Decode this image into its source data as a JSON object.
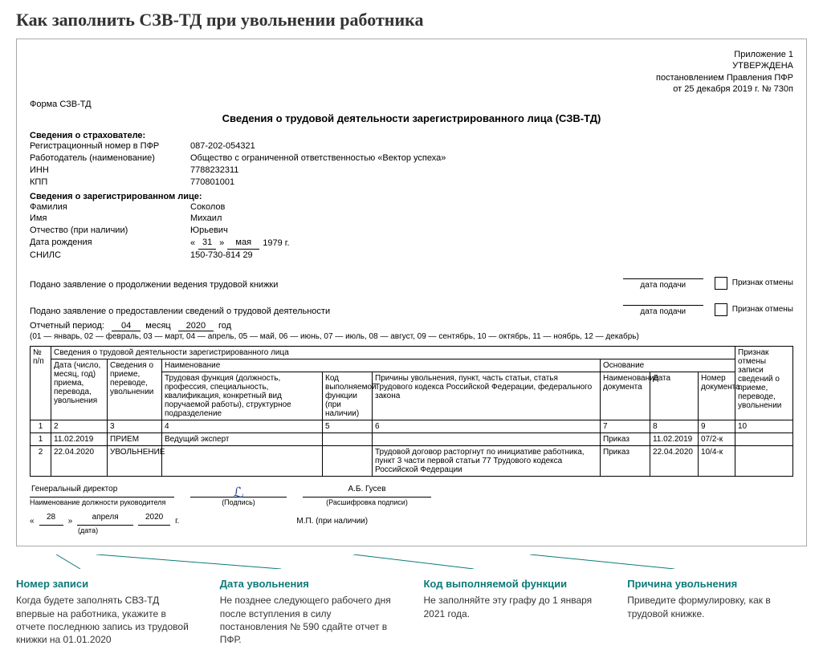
{
  "pageTitle": "Как заполнить СЗВ-ТД при увольнении работника",
  "topRight": {
    "l1": "Приложение 1",
    "l2": "УТВЕРЖДЕНА",
    "l3": "постановлением Правления ПФР",
    "l4": "от 25 декабря 2019 г. № 730п"
  },
  "formCode": "Форма СЗВ-ТД",
  "formTitle": "Сведения о трудовой деятельности зарегистрированного лица (СЗВ-ТД)",
  "sectionInsurer": "Сведения о страхователе:",
  "insurer": {
    "regLabel": "Регистрационный номер в ПФР",
    "regVal": "087-202-054321",
    "empLabel": "Работодатель (наименование)",
    "empVal": "Общество с ограниченной ответственностью «Вектор успеха»",
    "innLabel": "ИНН",
    "innVal": "7788232311",
    "kppLabel": "КПП",
    "kppVal": "770801001"
  },
  "sectionPerson": "Сведения о зарегистрированном лице:",
  "person": {
    "famLabel": "Фамилия",
    "famVal": "Соколов",
    "nameLabel": "Имя",
    "nameVal": "Михаил",
    "patLabel": "Отчество (при наличии)",
    "patVal": "Юрьевич",
    "dobLabel": "Дата рождения",
    "dobDay": "31",
    "dobMonth": "мая",
    "dobYear": "1979 г.",
    "snilsLabel": "СНИЛС",
    "snilsVal": "150-730-814 29"
  },
  "app1": "Подано заявление о продолжении ведения трудовой книжки",
  "app2": "Подано заявление о предоставлении сведений о трудовой деятельности",
  "dateSubmit": "дата подачи",
  "cancelFlag": "Признак отмены",
  "reportPeriod": {
    "label": "Отчетный период:",
    "monthVal": "04",
    "monthLbl": "месяц",
    "yearVal": "2020",
    "yearLbl": "год"
  },
  "monthsLine": "(01 — январь, 02 — февраль, 03 — март, 04 — апрель, 05 — май, 06 — июнь, 07 — июль, 08 — август, 09 — сентябрь, 10 — октябрь, 11 — ноябрь, 12 — декабрь)",
  "table": {
    "hdr_np": "№ п/п",
    "hdr_group": "Сведения о трудовой деятельности зарегистрированного лица",
    "hdr_cancel": "Признак отмены записи сведений о приеме, переводе, увольнении",
    "hdr_date": "Дата (число, месяц, год) приема, перевода, увольнения",
    "hdr_event": "Сведения о приеме, переводе, увольнении",
    "hdr_name": "Наименование",
    "hdr_func": "Трудовая функция (должность, профессия, специальность, квалификация, конкретный вид поручаемой работы), структурное подразделение",
    "hdr_code": "Код выполняемой функции (при наличии)",
    "hdr_reason": "Причины увольнения, пункт, часть статьи, статья Трудового кодекса Российской Федерации, федерального закона",
    "hdr_basis": "Основание",
    "hdr_docname": "Наименование документа",
    "hdr_docdate": "Дата",
    "hdr_docnum": "Номер документа",
    "nums": [
      "1",
      "2",
      "3",
      "4",
      "5",
      "6",
      "7",
      "8",
      "9",
      "10"
    ],
    "rows": [
      {
        "np": "1",
        "date": "11.02.2019",
        "event": "ПРИЕМ",
        "func": "Ведущий эксперт",
        "code": "",
        "reason": "",
        "docname": "Приказ",
        "docdate": "11.02.2019",
        "docnum": "07/2-к",
        "cancel": ""
      },
      {
        "np": "2",
        "date": "22.04.2020",
        "event": "УВОЛЬНЕНИЕ",
        "func": "",
        "code": "",
        "reason": "Трудовой договор расторгнут по инициативе работника, пункт 3 части первой статьи 77 Трудового кодекса Российской Федерации",
        "docname": "Приказ",
        "docdate": "22.04.2020",
        "docnum": "10/4-к",
        "cancel": ""
      }
    ]
  },
  "signature": {
    "position": "Генеральный директор",
    "positionUnder": "Наименование должности руководителя",
    "signUnder": "(Подпись)",
    "decode": "А.Б. Гусев",
    "decodeUnder": "(Расшифровка подписи)",
    "day": "28",
    "month": "апреля",
    "year": "2020",
    "g": "г.",
    "dateUnder": "(дата)",
    "mp": "М.П. (при наличии)"
  },
  "annotations": [
    {
      "title": "Номер записи",
      "body": "Когда будете заполнять СВЗ-ТД впервые на работника, укажите в отчете последнюю запись из трудовой книжки на 01.01.2020"
    },
    {
      "title": "Дата увольнения",
      "body": "Не позднее следующего рабочего дня после вступления в силу постановления № 590 сдайте отчет в ПФР."
    },
    {
      "title": "Код выполняемой функции",
      "body": "Не заполняйте эту графу до 1 января 2021 года."
    },
    {
      "title": "Причина увольнения",
      "body": "Приведите формулировку, как в трудовой книжке."
    }
  ]
}
